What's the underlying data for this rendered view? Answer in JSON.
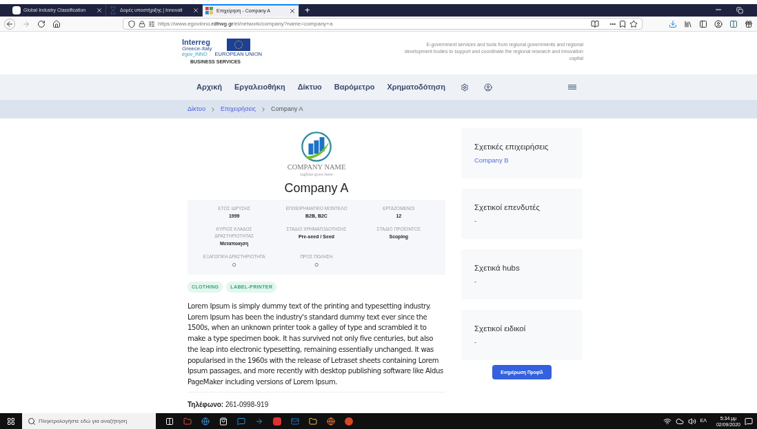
{
  "browser": {
    "tabs": [
      {
        "title": "Global Industry Classification",
        "selected": false
      },
      {
        "title": "Δομές υποστήριξης | Innovati",
        "selected": false
      },
      {
        "title": "Επιχείρηση - Company A",
        "selected": true
      }
    ],
    "new_tab": "+",
    "url_host": "https://www.egovinno.",
    "url_domain": "rdfrwg.gr",
    "url_path": "/el/network/company?name=company+a",
    "menu_dots": "•••"
  },
  "header": {
    "logo_title": "Interreg",
    "logo_sub": "Greece-Italy",
    "logo_project": "egov_INNO",
    "logo_eu": "EUROPEAN UNION",
    "logo_services": "BUSINESS SERVICES",
    "tagline": "E-government services and tools from regional governments and regional development bodies to support and coordinate the regional research and innovation capital"
  },
  "nav": {
    "items": [
      "Αρχική",
      "Εργαλειοθήκη",
      "Δίκτυο",
      "Βαρόμετρο",
      "Χρηματοδότηση"
    ]
  },
  "breadcrumb": [
    {
      "label": "Δίκτυο",
      "link": true
    },
    {
      "label": "Επιχειρήσεις",
      "link": true
    },
    {
      "label": "Company A",
      "link": false
    }
  ],
  "company": {
    "logo_name": "COMPANY NAME",
    "logo_tagline": "tagline goes here",
    "name": "Company A",
    "fields": [
      {
        "label": "ΕΤΟΣ ΙΔΡΥΣΗΣ",
        "kind": "text",
        "value": "1999"
      },
      {
        "label": "ΕΠΙΧΕΙΡΗΜΑΤΙΚΟ ΜΟΝΤΕΛΟ",
        "kind": "text",
        "value": "B2B, B2C"
      },
      {
        "label": "ΕΡΓΑΖΟΜΕΝΟΙ",
        "kind": "text",
        "value": "12"
      },
      {
        "label": "ΚΥΡΙΟΣ ΚΛΑΔΟΣ ΔΡΑΣΤΗΡΙΟΤΗΤΑΣ",
        "kind": "text",
        "value": "Μεταποιηση"
      },
      {
        "label": "ΣΤΑΔΙΟ ΧΡΗΜΑΤΟΔΟΤΗΣΗΣ",
        "kind": "text",
        "value": "Pre-seed / Seed"
      },
      {
        "label": "ΣΤΑΔΙΟ ΠΡΟΪΟΝΤΟΣ",
        "kind": "text",
        "value": "Scoping"
      },
      {
        "label": "ΕΞΑΓΩΓΙΚΗ ΔΡΑΣΤΗΡΙΟΤΗΤΑ",
        "kind": "symbol",
        "value": "○"
      },
      {
        "label": "ΠΡΟΣ ΠΩΛΗΣΗ",
        "kind": "symbol",
        "value": "○"
      }
    ],
    "tags": [
      "CLOTHING",
      "LABEL-PRINTER"
    ],
    "description": "Lorem Ipsum is simply dummy text of the printing and typesetting industry. Lorem Ipsum has been the industry's standard dummy text ever since the 1500s, when an unknown printer took a galley of type and scrambled it to make a type specimen book. It has survived not only five centuries, but also the leap into electronic typesetting, remaining essentially unchanged. It was popularised in the 1960s with the release of Letraset sheets containing Lorem Ipsum passages, and more recently with desktop publishing software like Aldus PageMaker including versions of Lorem Ipsum.",
    "phone": "**Τηλέφωνο:** 261-0998-919"
  },
  "sidebar": [
    {
      "title": "Σχετικές επιχειρήσεις",
      "value": "Company B",
      "link": true
    },
    {
      "title": "Σχετικοί επενδυτές",
      "value": "-",
      "link": false
    },
    {
      "title": "Σχετικά hubs",
      "value": "-",
      "link": false
    },
    {
      "title": "Σχετικοί ειδικοί",
      "value": "-",
      "link": false
    }
  ],
  "update_button": "Ενημέρωση Προφίλ",
  "taskbar": {
    "search_placeholder": "Πληκτρολογήστε εδώ για αναζήτηση",
    "language": "ΕΛ",
    "time": "5:34 μμ",
    "date": "02/09/2020"
  }
}
